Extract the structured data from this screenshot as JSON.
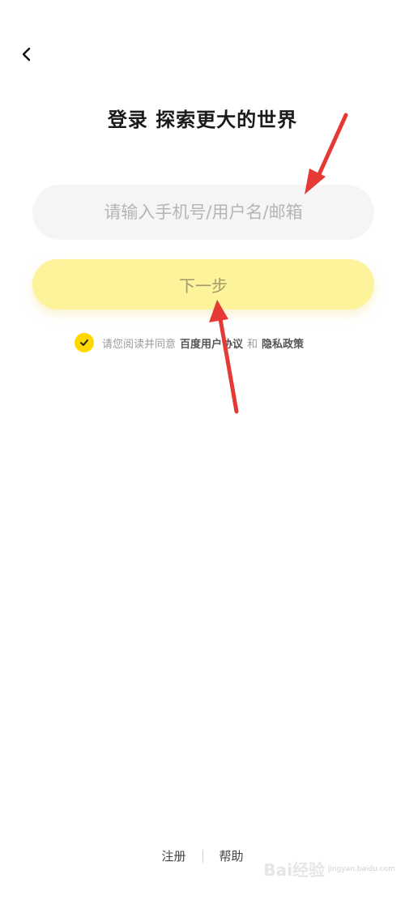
{
  "header": {
    "back_icon": "chevron-left-icon",
    "title": "登录 探索更大的世界"
  },
  "login": {
    "input_placeholder": "请输入手机号/用户名/邮箱",
    "input_value": "",
    "next_label": "下一步"
  },
  "agreement": {
    "checked": true,
    "prefix": "请您阅读并同意",
    "user_agreement": "百度用户协议",
    "conjunction": "和",
    "privacy_policy": "隐私政策"
  },
  "footer": {
    "register": "注册",
    "help": "帮助"
  },
  "watermark": {
    "text": "Bai经验",
    "sub": "jingyan.baidu.com"
  },
  "colors": {
    "accent_yellow": "#ffd800",
    "button_bg": "#fdf39a",
    "annotation_arrow": "#e53935"
  }
}
